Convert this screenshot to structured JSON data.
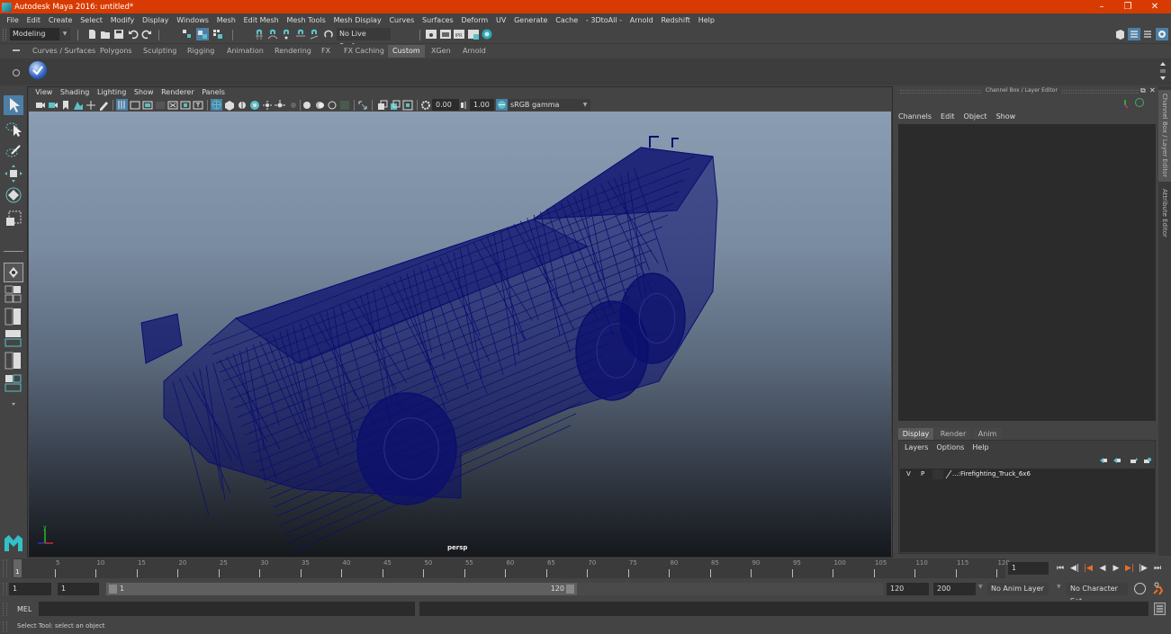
{
  "window": {
    "title": "Autodesk Maya 2016: untitled*",
    "controls": [
      "minimize",
      "restore",
      "close"
    ]
  },
  "menubar": [
    "File",
    "Edit",
    "Create",
    "Select",
    "Modify",
    "Display",
    "Windows",
    "Mesh",
    "Edit Mesh",
    "Mesh Tools",
    "Mesh Display",
    "Curves",
    "Surfaces",
    "Deform",
    "UV",
    "Generate",
    "Cache",
    "- 3DtoAll -",
    "Arnold",
    "Redshift",
    "Help"
  ],
  "toolbar": {
    "menuset": "Modeling",
    "live_surface": "No Live Surface"
  },
  "shelf": {
    "tabs": [
      "Curves / Surfaces",
      "Polygons",
      "Sculpting",
      "Rigging",
      "Animation",
      "Rendering",
      "FX",
      "FX Caching",
      "Custom",
      "XGen",
      "Arnold"
    ],
    "active_tab": "Custom"
  },
  "viewport": {
    "menu": [
      "View",
      "Shading",
      "Lighting",
      "Show",
      "Renderer",
      "Panels"
    ],
    "exposure": "0.00",
    "gamma": "1.00",
    "color_space": "sRGB gamma",
    "camera_label": "persp",
    "wire_color": "#0b0f6e",
    "axis_labels": {
      "y": "y"
    }
  },
  "channel_box": {
    "title": "Channel Box / Layer Editor",
    "menu": [
      "Channels",
      "Edit",
      "Object",
      "Show"
    ]
  },
  "layer_editor": {
    "tabs": [
      "Display",
      "Render",
      "Anim"
    ],
    "active_tab": "Display",
    "menu": [
      "Layers",
      "Options",
      "Help"
    ],
    "layers": [
      {
        "visible": "V",
        "playback": "P",
        "name": "...:Firefighting_Truck_6x6"
      }
    ]
  },
  "side_tabs": [
    "Channel Box / Layer Editor",
    "Attribute Editor"
  ],
  "timeline": {
    "ticks": [
      5,
      10,
      15,
      20,
      25,
      30,
      35,
      40,
      45,
      50,
      55,
      60,
      65,
      70,
      75,
      80,
      85,
      90,
      95,
      100,
      105,
      110,
      115,
      120
    ],
    "current_frame_marker": "1",
    "current_frame": "1",
    "range_start": 1,
    "range_end": 120
  },
  "range_slider": {
    "start_time": "1",
    "playback_start": "1",
    "slider_start": "1",
    "slider_end": "120",
    "playback_end": "120",
    "end_time": "200",
    "anim_layer": "No Anim Layer",
    "character_set": "No Character Set"
  },
  "command_line": {
    "language": "MEL",
    "input": "",
    "output": ""
  },
  "help_line": "Select Tool: select an object"
}
